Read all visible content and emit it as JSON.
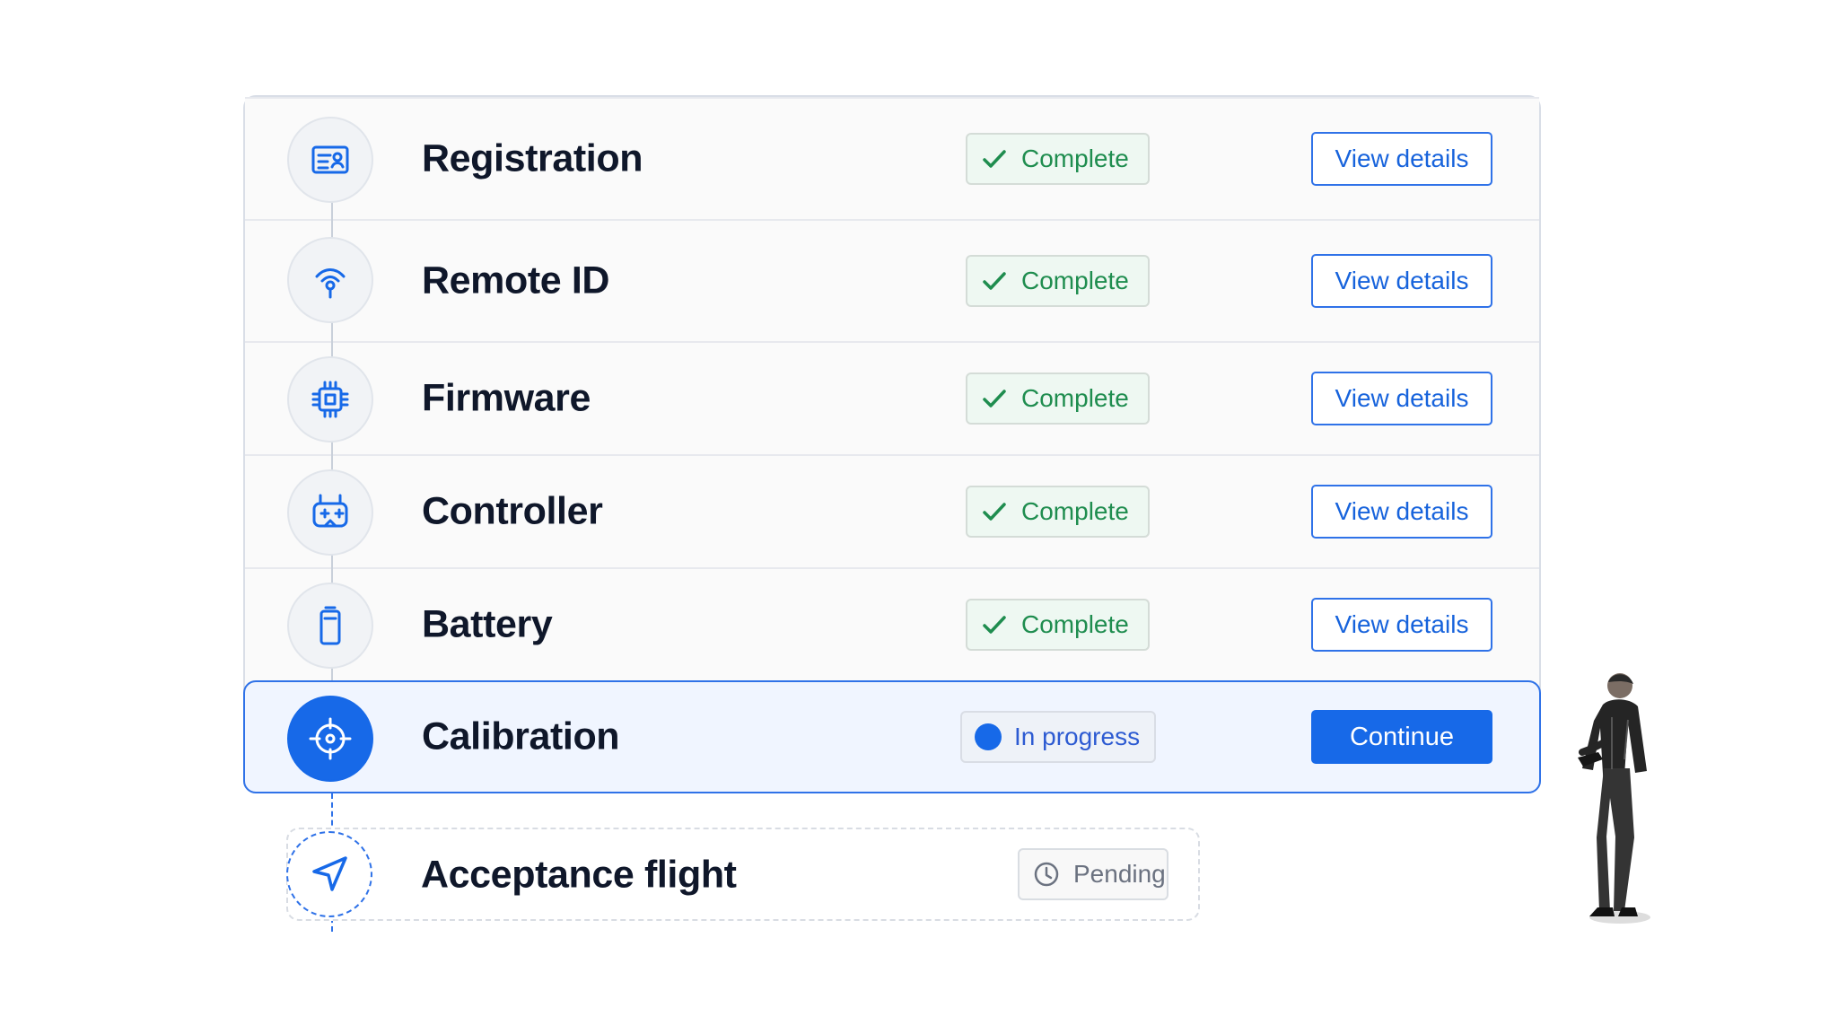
{
  "steps": [
    {
      "title": "Registration",
      "icon": "id-card-icon",
      "status": "Complete",
      "action": "View details"
    },
    {
      "title": "Remote ID",
      "icon": "broadcast-icon",
      "status": "Complete",
      "action": "View details"
    },
    {
      "title": "Firmware",
      "icon": "chip-icon",
      "status": "Complete",
      "action": "View details"
    },
    {
      "title": "Controller",
      "icon": "controller-icon",
      "status": "Complete",
      "action": "View details"
    },
    {
      "title": "Battery",
      "icon": "battery-icon",
      "status": "Complete",
      "action": "View details"
    },
    {
      "title": "Calibration",
      "icon": "crosshair-icon",
      "status": "In progress",
      "action": "Continue"
    }
  ],
  "pending": {
    "title": "Acceptance flight",
    "icon": "navigation-arrow-icon",
    "status": "Pending"
  },
  "colors": {
    "accent": "#1769e8",
    "complete": "#1f8d4f",
    "muted": "#6b7280",
    "border": "#d9dee7"
  },
  "status_icons": {
    "complete": "check-icon",
    "in_progress": "progress-dot-icon",
    "pending": "clock-icon"
  },
  "illustration": {
    "type": "person-with-phone"
  }
}
